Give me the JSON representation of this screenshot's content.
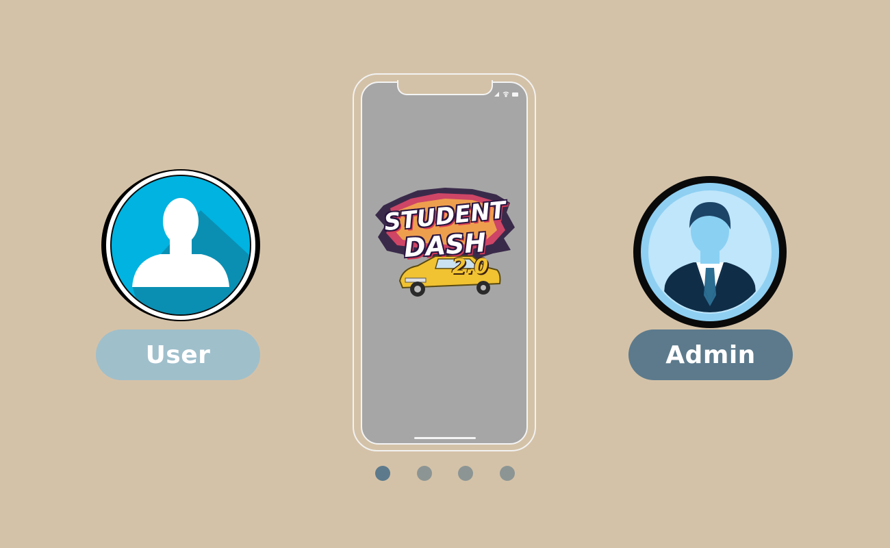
{
  "roles": {
    "user": {
      "label": "User",
      "icon": "user-silhouette-icon",
      "color": "#9fbfcb"
    },
    "admin": {
      "label": "Admin",
      "icon": "admin-businessman-icon",
      "color": "#5c7a8c"
    }
  },
  "phone": {
    "logo": {
      "line1": "STUDENT",
      "line2": "DASH",
      "version": "2.0",
      "icon": "taxi-car-icon"
    },
    "status_icons": [
      "signal-icon",
      "wifi-icon",
      "battery-icon"
    ]
  },
  "pagination": {
    "total": 4,
    "active": 1
  },
  "colors": {
    "background": "#d4c2a8",
    "screen": "#a6a6a6",
    "active_dot": "#5c7a8c",
    "inactive_dot": "#8c9594"
  }
}
